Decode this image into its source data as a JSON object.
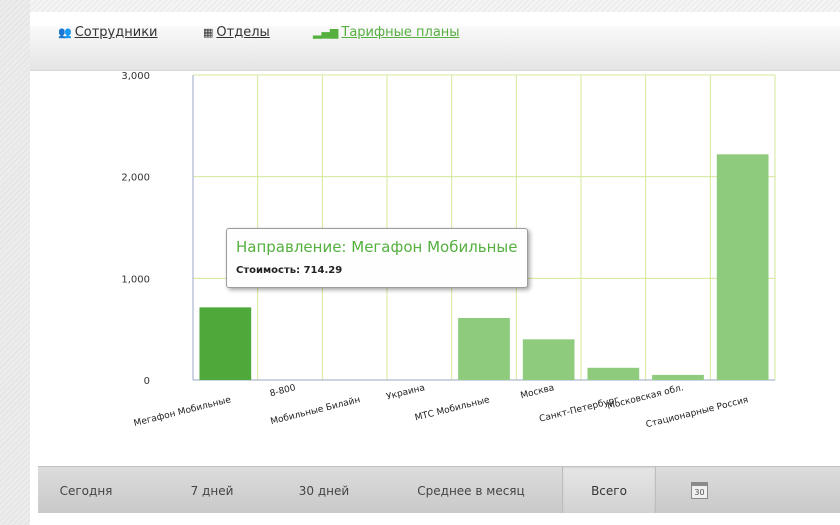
{
  "tabs": [
    {
      "label": "Сотрудники",
      "icon": "users-icon",
      "glyph": "👥",
      "active": false
    },
    {
      "label": "Отделы",
      "icon": "departments-icon",
      "glyph": "▦",
      "active": false
    },
    {
      "label": "Тарифные планы",
      "icon": "signal-bars-icon",
      "glyph": "▂▄▆",
      "active": true
    }
  ],
  "chart_data": {
    "type": "bar",
    "categories": [
      "Мегафон Мобильные",
      "8-800",
      "Мобильные Билайн",
      "Украина",
      "МТС Мобильные",
      "Москва",
      "Санкт-Петербург",
      "Московская обл.",
      "Стационарные Россия"
    ],
    "values": [
      714.29,
      0,
      0,
      0,
      610,
      400,
      120,
      50,
      2220
    ],
    "ylim": [
      0,
      3000
    ],
    "yticks": [
      0,
      1000,
      2000,
      3000
    ],
    "ytick_labels": [
      "0",
      "1,000",
      "2,000",
      "3,000"
    ],
    "highlight_index": 0,
    "colors": {
      "highlight": "#4ea93a",
      "bar": "#8fcb7d",
      "grid": "#d3e89a",
      "axis": "#9aa8c8"
    },
    "grid": true
  },
  "tooltip": {
    "title": "Направление: Мегафон Мобильные",
    "value_label": "Стоимость: 714.29"
  },
  "range_buttons": [
    {
      "label": "Сегодня",
      "active": false
    },
    {
      "label": "7 дней",
      "active": false
    },
    {
      "label": "30 дней",
      "active": false
    },
    {
      "label": "Среднее в месяц",
      "active": false
    },
    {
      "label": "Всего",
      "active": true
    }
  ],
  "calendar": {
    "icon": "calendar-icon",
    "text": "30"
  }
}
